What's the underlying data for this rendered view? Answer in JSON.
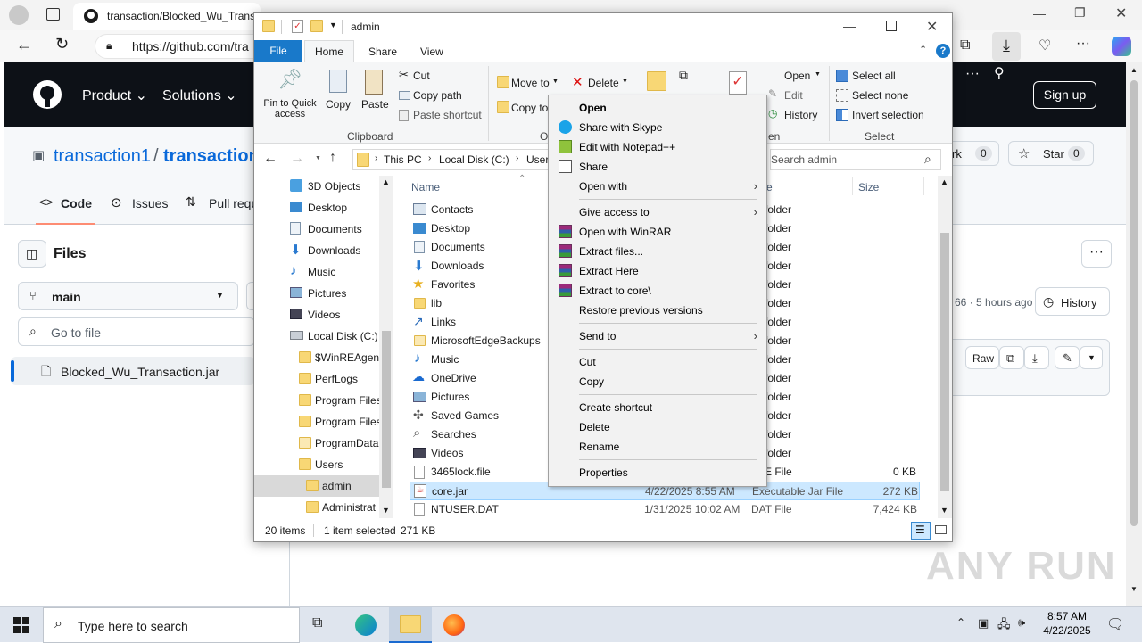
{
  "browser": {
    "tab_title": "transaction/Blocked_Wu_Transa",
    "url": "https://github.com/tra"
  },
  "github": {
    "nav": [
      "Product",
      "Solutions"
    ],
    "sign_up": "Sign up",
    "repo_owner": "transaction1",
    "repo_sep": "/",
    "repo_name": "transaction",
    "fork_label": "rk",
    "fork_count": "0",
    "star_label": "Star",
    "star_count": "0",
    "tabs": {
      "code": "Code",
      "issues": "Issues",
      "pulls": "Pull requ"
    },
    "files_title": "Files",
    "branch": "main",
    "go_to_file": "Go to file",
    "file_item": "Blocked_Wu_Transaction.jar",
    "commit_info": "66 · 5 hours ago",
    "history": "History",
    "raw": "Raw"
  },
  "explorer": {
    "title": "admin",
    "ribbon_tabs": {
      "file": "File",
      "home": "Home",
      "share": "Share",
      "view": "View"
    },
    "clipboard": {
      "pin": "Pin to Quick access",
      "copy": "Copy",
      "paste": "Paste",
      "cut": "Cut",
      "copy_path": "Copy path",
      "paste_shortcut": "Paste shortcut",
      "group": "Clipboard"
    },
    "organize": {
      "move_to": "Move to",
      "delete": "Delete",
      "copy_to": "Copy to",
      "group": "O"
    },
    "open_group": {
      "open": "Open",
      "edit": "Edit",
      "history": "History",
      "group": "en"
    },
    "select_group": {
      "select_all": "Select all",
      "select_none": "Select none",
      "invert": "Invert selection",
      "group": "Select"
    },
    "breadcrumb": [
      "This PC",
      "Local Disk (C:)",
      "User"
    ],
    "search_placeholder": "Search admin",
    "columns": {
      "name": "Name",
      "type": "e",
      "size": "Size"
    },
    "nav_pane": [
      {
        "label": "3D Objects",
        "icon": "3d-objects-icon"
      },
      {
        "label": "Desktop",
        "icon": "desktop-icon"
      },
      {
        "label": "Documents",
        "icon": "documents-icon"
      },
      {
        "label": "Downloads",
        "icon": "downloads-icon"
      },
      {
        "label": "Music",
        "icon": "music-icon"
      },
      {
        "label": "Pictures",
        "icon": "pictures-icon"
      },
      {
        "label": "Videos",
        "icon": "videos-icon"
      },
      {
        "label": "Local Disk (C:)",
        "icon": "drive-icon"
      },
      {
        "label": "$WinREAgent",
        "icon": "folder-icon"
      },
      {
        "label": "PerfLogs",
        "icon": "folder-icon"
      },
      {
        "label": "Program Files",
        "icon": "folder-icon"
      },
      {
        "label": "Program Files",
        "icon": "folder-icon"
      },
      {
        "label": "ProgramData",
        "icon": "folder-icon"
      },
      {
        "label": "Users",
        "icon": "folder-icon"
      },
      {
        "label": "admin",
        "icon": "folder-icon"
      },
      {
        "label": "Administrat",
        "icon": "folder-icon"
      }
    ],
    "files": [
      {
        "name": "Contacts",
        "date": "",
        "type": "folder",
        "size": ""
      },
      {
        "name": "Desktop",
        "date": "",
        "type": "folder",
        "size": ""
      },
      {
        "name": "Documents",
        "date": "",
        "type": "folder",
        "size": ""
      },
      {
        "name": "Downloads",
        "date": "",
        "type": "folder",
        "size": ""
      },
      {
        "name": "Favorites",
        "date": "",
        "type": "folder",
        "size": ""
      },
      {
        "name": "lib",
        "date": "",
        "type": "folder",
        "size": ""
      },
      {
        "name": "Links",
        "date": "",
        "type": "folder",
        "size": ""
      },
      {
        "name": "MicrosoftEdgeBackups",
        "date": "",
        "type": "folder",
        "size": ""
      },
      {
        "name": "Music",
        "date": "",
        "type": "folder",
        "size": ""
      },
      {
        "name": "OneDrive",
        "date": "",
        "type": "folder",
        "size": ""
      },
      {
        "name": "Pictures",
        "date": "",
        "type": "folder",
        "size": ""
      },
      {
        "name": "Saved Games",
        "date": "",
        "type": "folder",
        "size": ""
      },
      {
        "name": "Searches",
        "date": "",
        "type": "folder",
        "size": ""
      },
      {
        "name": "Videos",
        "date": "",
        "type": "folder",
        "size": ""
      },
      {
        "name": "3465lock.file",
        "date": "",
        "type": "E File",
        "size": "0 KB"
      },
      {
        "name": "core.jar",
        "date": "4/22/2025 8:55 AM",
        "type": "Executable Jar File",
        "size": "272 KB"
      },
      {
        "name": "NTUSER.DAT",
        "date": "1/31/2025 10:02 AM",
        "type": "DAT File",
        "size": "7,424 KB"
      }
    ],
    "status": {
      "items": "20 items",
      "selected": "1 item selected",
      "size": "271 KB"
    }
  },
  "context_menu": [
    {
      "label": "Open",
      "bold": true
    },
    {
      "label": "Share with Skype",
      "icon": "skype-icon"
    },
    {
      "label": "Edit with Notepad++",
      "icon": "notepadpp-icon"
    },
    {
      "label": "Share",
      "icon": "share-icon"
    },
    {
      "label": "Open with",
      "submenu": true
    },
    {
      "sep": true
    },
    {
      "label": "Give access to",
      "submenu": true
    },
    {
      "label": "Open with WinRAR",
      "icon": "winrar-icon"
    },
    {
      "label": "Extract files...",
      "icon": "winrar-icon"
    },
    {
      "label": "Extract Here",
      "icon": "winrar-icon"
    },
    {
      "label": "Extract to core\\",
      "icon": "winrar-icon"
    },
    {
      "label": "Restore previous versions"
    },
    {
      "sep": true
    },
    {
      "label": "Send to",
      "submenu": true
    },
    {
      "sep": true
    },
    {
      "label": "Cut"
    },
    {
      "label": "Copy"
    },
    {
      "sep": true
    },
    {
      "label": "Create shortcut"
    },
    {
      "label": "Delete"
    },
    {
      "label": "Rename"
    },
    {
      "sep": true
    },
    {
      "label": "Properties"
    }
  ],
  "taskbar": {
    "search_placeholder": "Type here to search",
    "time": "8:57 AM",
    "date": "4/22/2025"
  },
  "watermark": "ANY RUN",
  "colors": {
    "github_header": "#0d1117",
    "explorer_file_tab": "#1979ca",
    "selection": "#cce8ff",
    "link": "#0969da"
  }
}
